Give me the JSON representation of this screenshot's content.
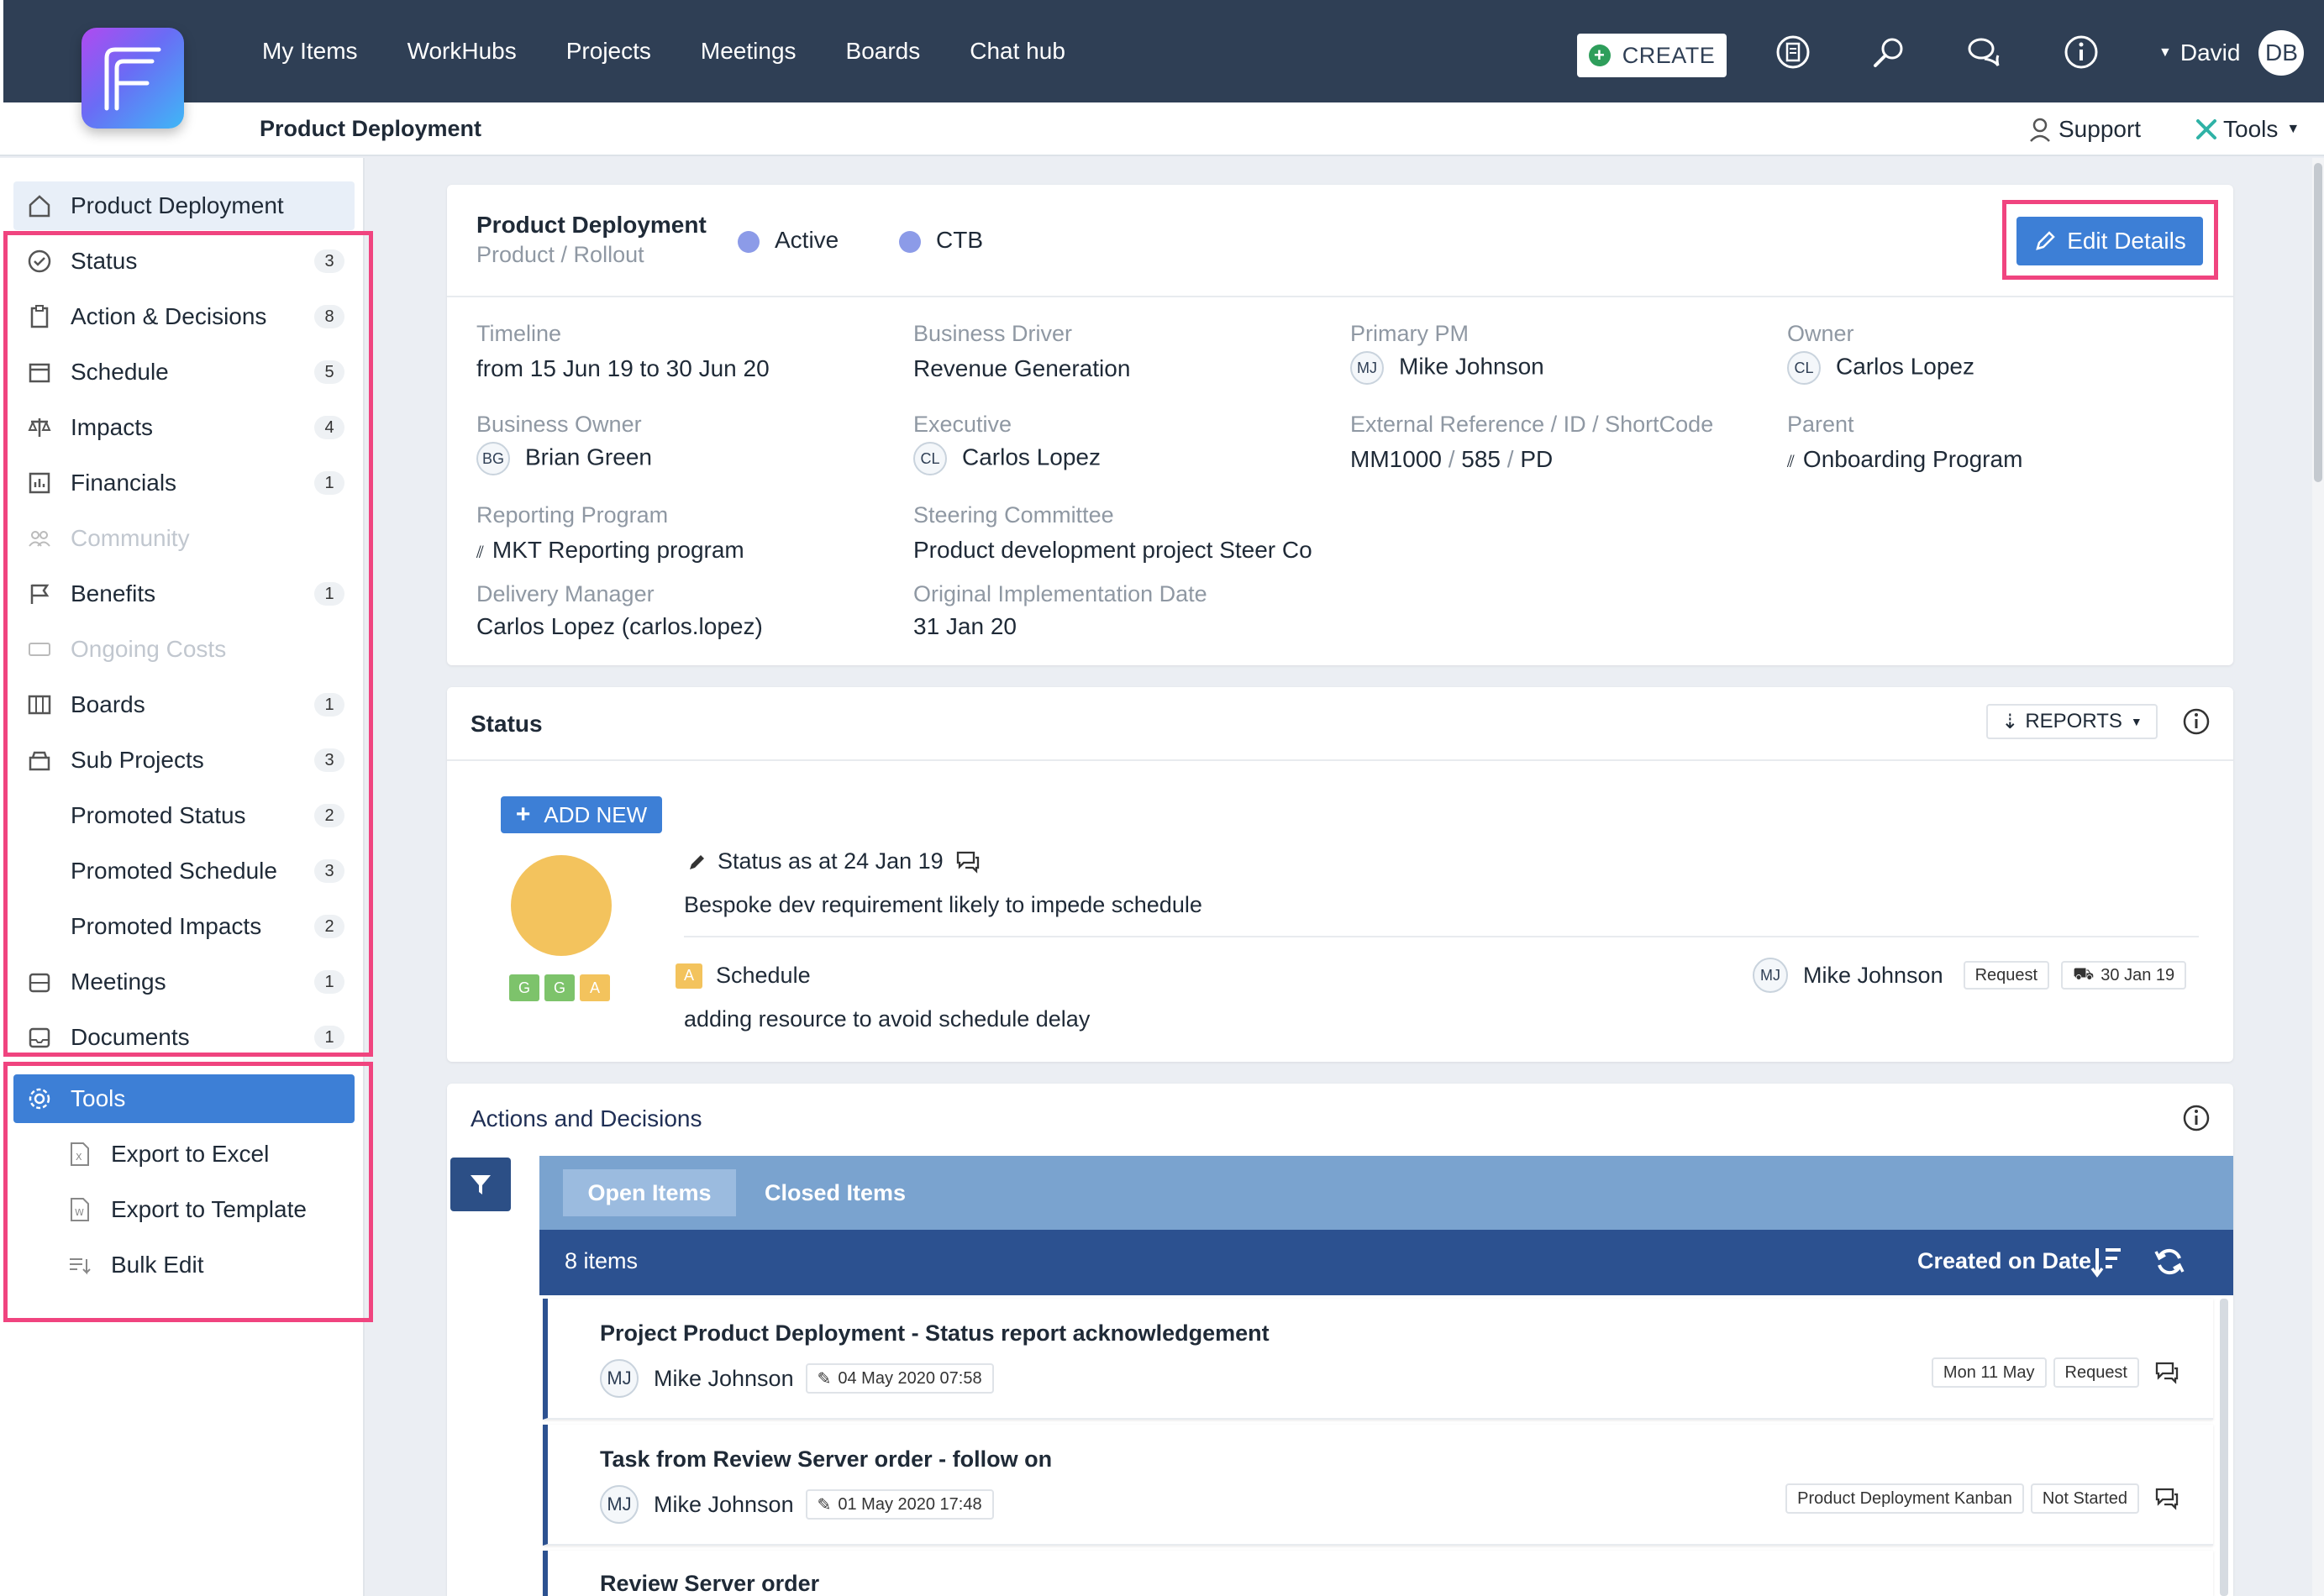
{
  "topnav": {
    "items": [
      "My Items",
      "WorkHubs",
      "Projects",
      "Meetings",
      "Boards",
      "Chat hub"
    ],
    "create_label": "CREATE",
    "user_name": "David",
    "user_initials": "DB"
  },
  "subbar": {
    "breadcrumb": "Product Deployment",
    "support_label": "Support",
    "tools_label": "Tools"
  },
  "sidebar": {
    "home": "Product Deployment",
    "items": [
      {
        "label": "Status",
        "count": "3"
      },
      {
        "label": "Action & Decisions",
        "count": "8"
      },
      {
        "label": "Schedule",
        "count": "5"
      },
      {
        "label": "Impacts",
        "count": "4"
      },
      {
        "label": "Financials",
        "count": "1"
      },
      {
        "label": "Community",
        "count": ""
      },
      {
        "label": "Benefits",
        "count": "1"
      },
      {
        "label": "Ongoing Costs",
        "count": ""
      },
      {
        "label": "Boards",
        "count": "1"
      },
      {
        "label": "Sub Projects",
        "count": "3"
      },
      {
        "label": "Promoted Status",
        "count": "2"
      },
      {
        "label": "Promoted Schedule",
        "count": "3"
      },
      {
        "label": "Promoted Impacts",
        "count": "2"
      },
      {
        "label": "Meetings",
        "count": "1"
      },
      {
        "label": "Documents",
        "count": "1"
      }
    ],
    "tools": "Tools",
    "tools_items": [
      "Export to Excel",
      "Export to Template",
      "Bulk Edit"
    ]
  },
  "details": {
    "title": "Product Deployment",
    "subtitle": "Product / Rollout",
    "state": "Active",
    "category": "CTB",
    "edit_label": "Edit Details",
    "fields": {
      "timeline_label": "Timeline",
      "timeline_value": "from 15 Jun 19 to 30 Jun 20",
      "driver_label": "Business Driver",
      "driver_value": "Revenue Generation",
      "pm_label": "Primary PM",
      "pm_initials": "MJ",
      "pm_value": "Mike Johnson",
      "owner_label": "Owner",
      "owner_initials": "CL",
      "owner_value": "Carlos Lopez",
      "bo_label": "Business Owner",
      "bo_initials": "BG",
      "bo_value": "Brian Green",
      "exec_label": "Executive",
      "exec_initials": "CL",
      "exec_value": "Carlos Lopez",
      "ext_label": "External Reference / ID / ShortCode",
      "ext_ref": "MM1000",
      "ext_sep1": "/",
      "ext_id": "585",
      "ext_sep2": "/",
      "ext_code": "PD",
      "parent_label": "Parent",
      "parent_value": "Onboarding Program",
      "rp_label": "Reporting Program",
      "rp_value": "MKT Reporting program",
      "sc_label": "Steering Committee",
      "sc_value": "Product development project Steer Co",
      "dm_label": "Delivery Manager",
      "dm_value": "Carlos Lopez (carlos.lopez)",
      "oid_label": "Original Implementation Date",
      "oid_value": "31 Jan 20"
    }
  },
  "status": {
    "title": "Status",
    "reports_label": "REPORTS",
    "add_new": "ADD NEW",
    "rag": [
      "G",
      "G",
      "A"
    ],
    "entry_title": "Status as at 24 Jan 19",
    "entry_text": "Bespoke dev requirement likely to impede schedule",
    "schedule_badge": "A",
    "schedule_label": "Schedule",
    "schedule_initials": "MJ",
    "schedule_person": "Mike Johnson",
    "schedule_tag": "Request",
    "schedule_date": "30 Jan 19",
    "schedule_note": "adding resource to avoid schedule delay",
    "colors": {
      "amber": "#f3c35d",
      "green": "#7dc36b"
    }
  },
  "actions": {
    "title": "Actions and Decisions",
    "tab_open": "Open Items",
    "tab_closed": "Closed Items",
    "count_label": "8 items",
    "sort_label": "Created on Date",
    "rows": [
      {
        "title": "Project Product Deployment - Status report acknowledgement",
        "initials": "MJ",
        "person": "Mike Johnson",
        "stamp": "04 May 2020 07:58",
        "tags": [
          "Mon 11 May",
          "Request"
        ]
      },
      {
        "title": "Task from Review Server order - follow on",
        "initials": "MJ",
        "person": "Mike Johnson",
        "stamp": "01 May 2020 17:48",
        "tags": [
          "Product Deployment Kanban",
          "Not Started"
        ]
      },
      {
        "title": "Review Server order"
      }
    ]
  }
}
